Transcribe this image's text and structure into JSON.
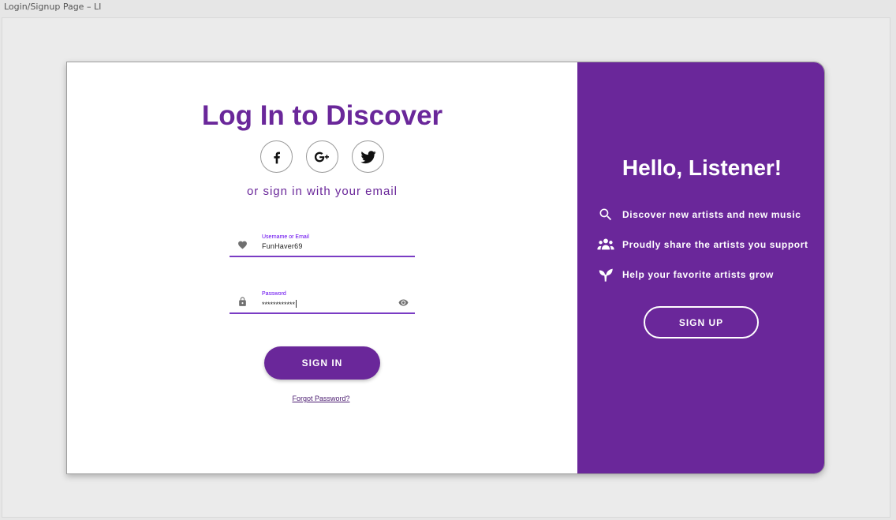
{
  "frame": {
    "label": "Login/Signup Page – LI"
  },
  "login": {
    "title": "Log In to Discover",
    "social": [
      {
        "icon": "facebook-icon"
      },
      {
        "icon": "google-plus-icon"
      },
      {
        "icon": "twitter-icon"
      }
    ],
    "email_hint": "or sign in with your email",
    "username": {
      "label": "Username or Email",
      "value": "FunHaver69",
      "icon": "heart-icon"
    },
    "password": {
      "label": "Password",
      "value": "************",
      "icon": "lock-icon",
      "trail_icon": "eye-icon"
    },
    "signin_label": "SIGN IN",
    "forgot_label": "Forgot Password?"
  },
  "welcome": {
    "title": "Hello, Listener!",
    "features": [
      {
        "icon": "search-icon",
        "text": "Discover new artists and new music"
      },
      {
        "icon": "group-icon",
        "text": "Proudly share the artists you support"
      },
      {
        "icon": "sprout-icon",
        "text": "Help your favorite artists grow"
      }
    ],
    "signup_label": "SIGN UP"
  },
  "colors": {
    "brand": "#6a279a",
    "accent": "#6200ee",
    "icon_gray": "#707070"
  }
}
